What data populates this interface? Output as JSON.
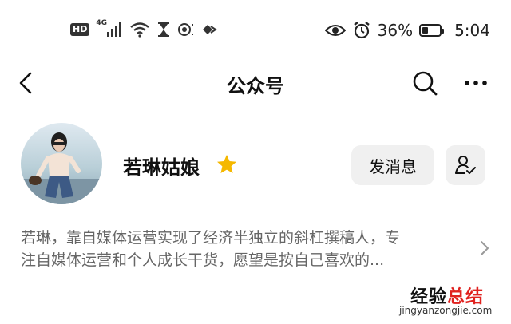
{
  "status_bar": {
    "hd_label": "HD",
    "network_label": "4G",
    "battery_percent_text": "36%",
    "battery_level": 0.36,
    "time": "5:04",
    "icons": [
      "hd-icon",
      "signal-icon",
      "wifi-icon",
      "hourglass-icon",
      "nfc-icon",
      "data-saver-icon",
      "eye-icon",
      "alarm-icon",
      "battery-icon"
    ]
  },
  "nav": {
    "title": "公众号",
    "icons": [
      "back-icon",
      "search-icon",
      "more-icon"
    ]
  },
  "profile": {
    "name": "若琳姑娘",
    "star_color": "#f5b800",
    "message_button": "发消息",
    "follow_icon": "user-check-icon",
    "description_lines": [
      "若琳，靠自媒体运营实现了经济半独立的斜杠撰稿人，专",
      "注自媒体运营和个人成长干货，愿望是按自己喜欢的..."
    ]
  },
  "watermark": {
    "title_part1": "经验",
    "title_part2": "总结",
    "url": "jingyanzongjie.com"
  }
}
